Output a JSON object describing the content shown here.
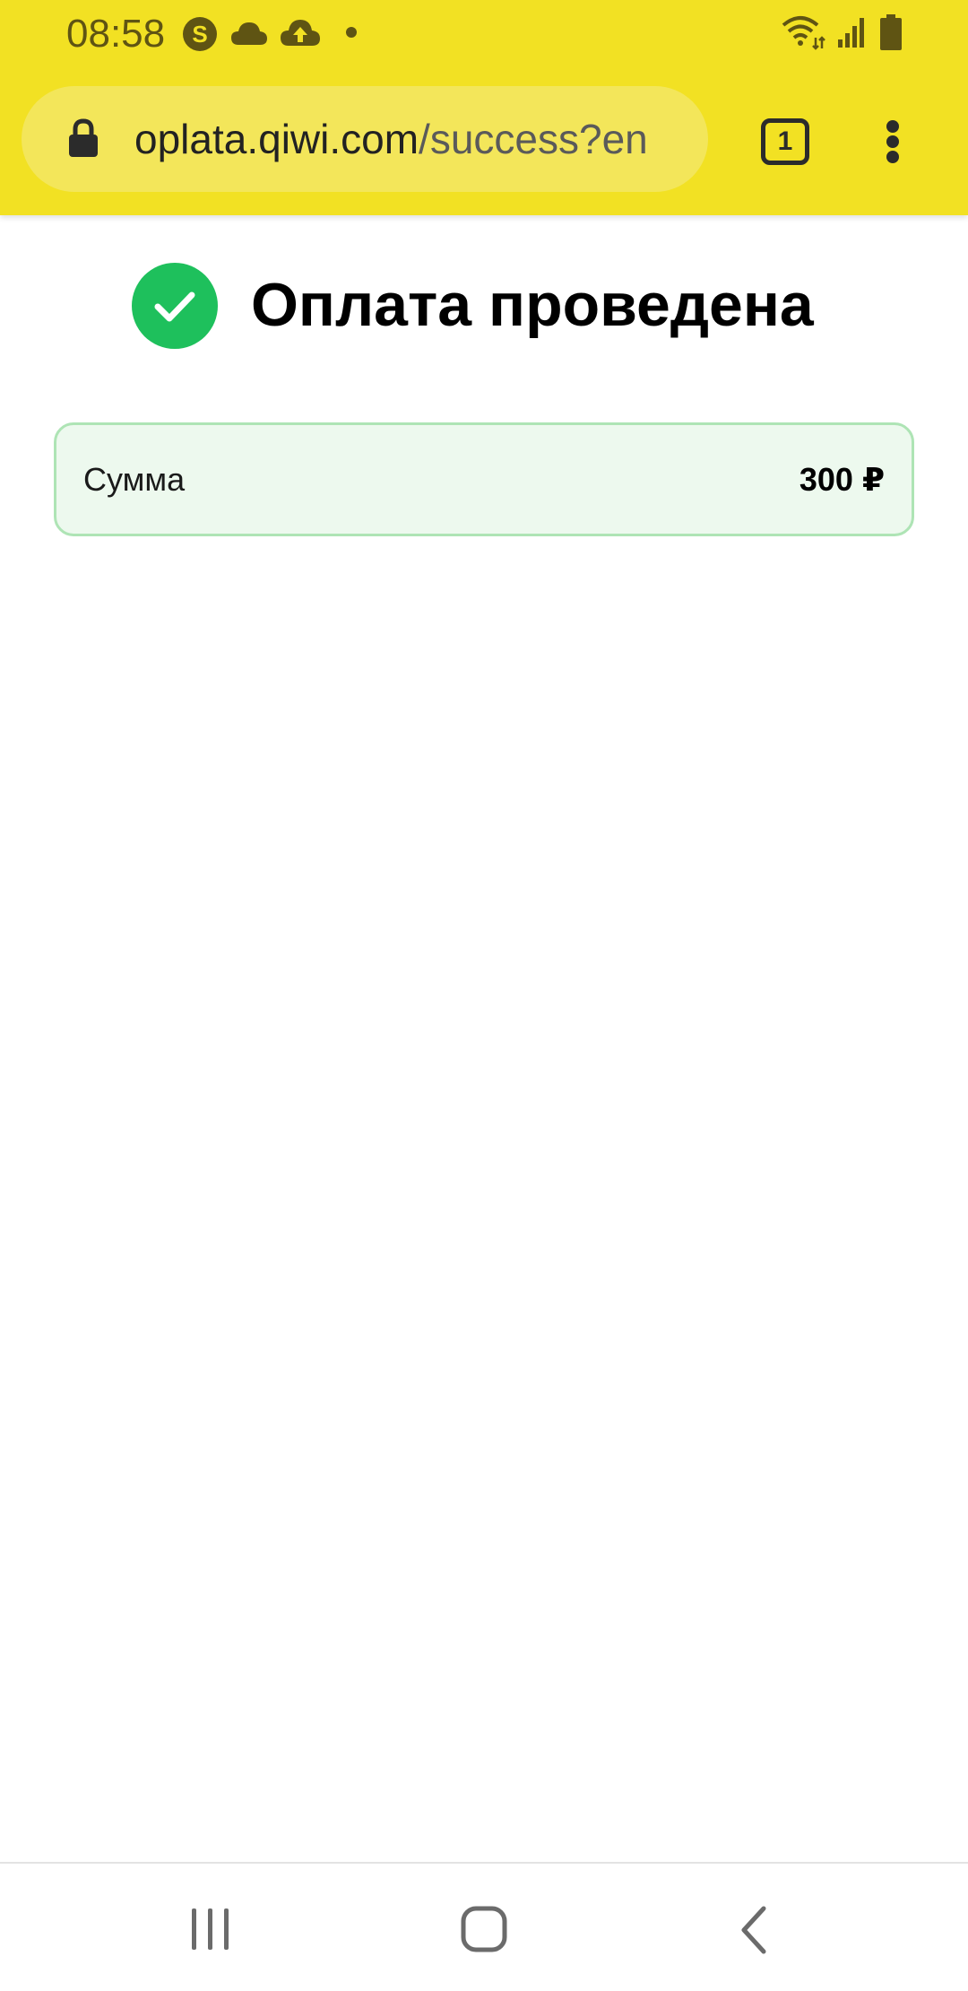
{
  "status_bar": {
    "time": "08:58",
    "left_icons": [
      "skype-icon",
      "cloud-icon",
      "cloud-upload-icon",
      "notification-dot-icon"
    ],
    "right_icons": [
      "wifi-icon",
      "signal-icon",
      "battery-icon"
    ]
  },
  "browser": {
    "url_host": "oplata.qiwi.com",
    "url_path": "/success?en",
    "tab_count": "1",
    "toolbar_color": "#f2e123"
  },
  "page": {
    "title": "Оплата проведена",
    "success_color": "#1ec05c",
    "amount_label": "Сумма",
    "amount_value": "300 ₽"
  },
  "nav_bar": {
    "buttons": [
      "recents-icon",
      "home-icon",
      "back-icon"
    ]
  }
}
